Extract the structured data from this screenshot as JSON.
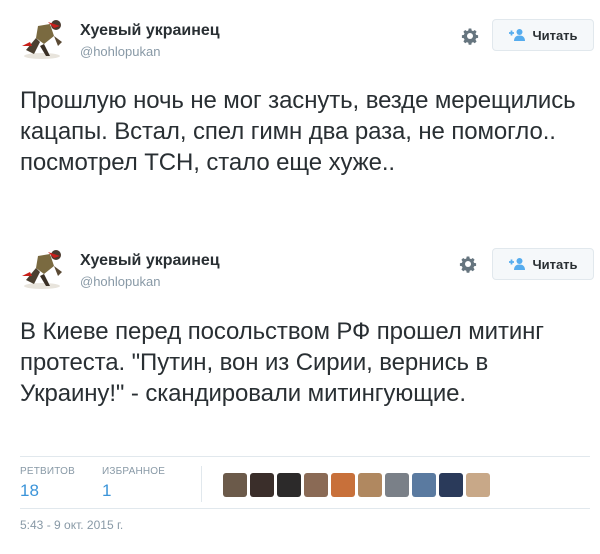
{
  "tweets": [
    {
      "author_name": "Хуевый украинец",
      "author_handle": "@hohlopukan",
      "follow_label": "Читать",
      "text": "Прошлую ночь не мог заснуть, везде мерещились кацапы. Встал, спел гимн два раза, не помогло.. посмотрел ТСН, стало еще хуже.."
    },
    {
      "author_name": "Хуевый украинец",
      "author_handle": "@hohlopukan",
      "follow_label": "Читать",
      "text": "В Киеве перед посольством РФ прошел митинг протеста. \"Путин, вон из Сирии, вернись в Украину!\" - скандировали митингующие.",
      "stats": {
        "retweets_label": "РЕТВИТОВ",
        "retweets_count": "18",
        "favorites_label": "ИЗБРАННОЕ",
        "favorites_count": "1"
      },
      "favoriter_avatar_colors": [
        "#6b5a4a",
        "#3a2e2a",
        "#2c2a2a",
        "#8a6a55",
        "#c8703a",
        "#b08860",
        "#7a8088",
        "#5a7aa0",
        "#2a3a5a",
        "#c8a888"
      ],
      "timestamp": "5:43 - 9 окт. 2015 г."
    }
  ],
  "colors": {
    "link": "#3b94d9",
    "muted": "#8899a6",
    "text": "#292f33",
    "border": "#e1e8ed"
  },
  "icons": {
    "gear": "gear-icon",
    "follow": "add-user-icon"
  }
}
